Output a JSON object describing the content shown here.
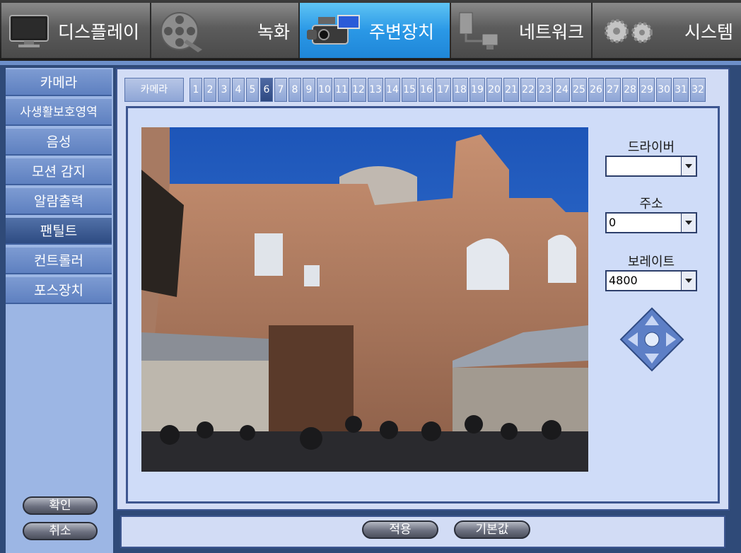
{
  "top_tabs": [
    {
      "label": "디스플레이",
      "icon": "monitor-icon",
      "active": false
    },
    {
      "label": "녹화",
      "icon": "film-reel-icon",
      "active": false
    },
    {
      "label": "주변장치",
      "icon": "camcorder-icon",
      "active": true
    },
    {
      "label": "네트워크",
      "icon": "network-icon",
      "active": false
    },
    {
      "label": "시스템",
      "icon": "gears-icon",
      "active": false
    }
  ],
  "sidebar": {
    "items": [
      {
        "label": "카메라",
        "active": false
      },
      {
        "label": "사생활보호영역",
        "active": false
      },
      {
        "label": "음성",
        "active": false
      },
      {
        "label": "모션 감지",
        "active": false
      },
      {
        "label": "알람출력",
        "active": false
      },
      {
        "label": "팬틸트",
        "active": true
      },
      {
        "label": "컨트롤러",
        "active": false
      },
      {
        "label": "포스장치",
        "active": false
      }
    ],
    "confirm_label": "확인",
    "cancel_label": "취소"
  },
  "camera_tabs": {
    "label": "카메라",
    "numbers": [
      "1",
      "2",
      "3",
      "4",
      "5",
      "6",
      "7",
      "8",
      "9",
      "10",
      "11",
      "12",
      "13",
      "14",
      "15",
      "16",
      "17",
      "18",
      "19",
      "20",
      "21",
      "22",
      "23",
      "24",
      "25",
      "26",
      "27",
      "28",
      "29",
      "30",
      "31",
      "32"
    ],
    "selected": "6"
  },
  "pantilt": {
    "driver_label": "드라이버",
    "driver_value": "",
    "address_label": "주소",
    "address_value": "0",
    "baudrate_label": "보레이트",
    "baudrate_value": "4800"
  },
  "footer": {
    "apply_label": "적용",
    "default_label": "기본값"
  }
}
